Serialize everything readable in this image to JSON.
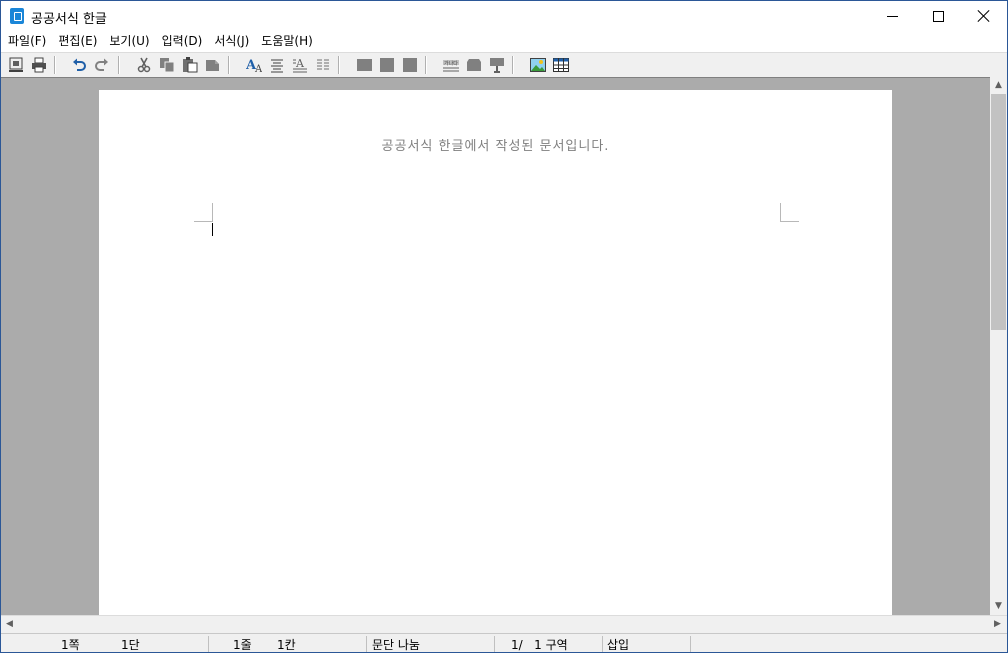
{
  "window": {
    "title": "공공서식 한글"
  },
  "menu": [
    {
      "label": "파일(F)"
    },
    {
      "label": "편집(E)"
    },
    {
      "label": "보기(U)"
    },
    {
      "label": "입력(D)"
    },
    {
      "label": "서식(J)"
    },
    {
      "label": "도움말(H)"
    }
  ],
  "toolbar": {
    "icons": [
      "print-preview-icon",
      "print-icon",
      "undo-icon",
      "redo-icon",
      "cut-icon",
      "copy-icon",
      "paste-icon",
      "format-painter-icon",
      "char-shape-icon",
      "para-shape-icon",
      "style-icon",
      "columns-icon",
      "table-disabled-icon",
      "box-disabled-icon",
      "chart-disabled-icon",
      "text-field-icon",
      "shape-icon",
      "draw-icon",
      "image-insert-icon",
      "table-insert-icon"
    ]
  },
  "document": {
    "notice": "공공서식 한글에서 작성된 문서입니다."
  },
  "status": {
    "page": "1쪽",
    "column": "1단",
    "line": "1줄",
    "char": "1칸",
    "paragraph_break": "문단 나눔",
    "section": "1/   1 구역",
    "mode": "삽입"
  },
  "colors": {
    "workspace_bg": "#ababab",
    "notice_text": "#7f7f7f",
    "app_icon": "#1a86d8"
  }
}
